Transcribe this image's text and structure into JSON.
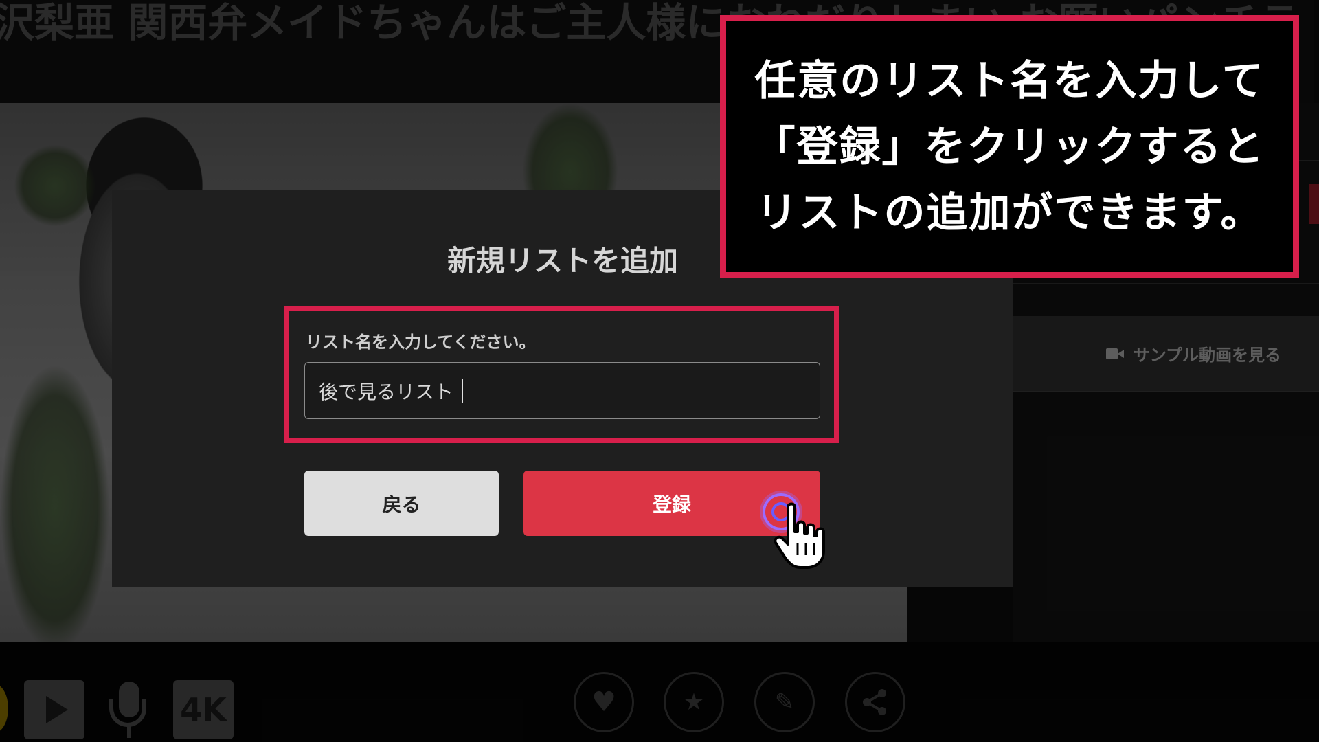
{
  "page": {
    "title": "沢梨亜 関西弁メイドちゃんはご主人様におねだりしまい お願いパンチラ"
  },
  "side_panel": {
    "sample_video_label": "サンプル動画を見る"
  },
  "modal": {
    "title": "新規リストを追加",
    "field_label": "リスト名を入力してください。",
    "list_name_value": "後で見るリスト",
    "back_label": "戻る",
    "register_label": "登録"
  },
  "annotation": {
    "lines": [
      "任意のリスト名を入力して",
      "「登録」をクリックすると",
      "リストの追加ができます。"
    ],
    "highlight_color": "#d71f4b"
  },
  "player_controls": {
    "quality_badge": "4K",
    "icons": [
      "coin-icon",
      "play-icon",
      "mic-icon",
      "heart-icon",
      "star-comment-icon",
      "edit-icon",
      "share-icon"
    ]
  },
  "colors": {
    "primary_button": "#dc3545",
    "secondary_button": "#dedede",
    "modal_bg": "#1f1f1f"
  }
}
